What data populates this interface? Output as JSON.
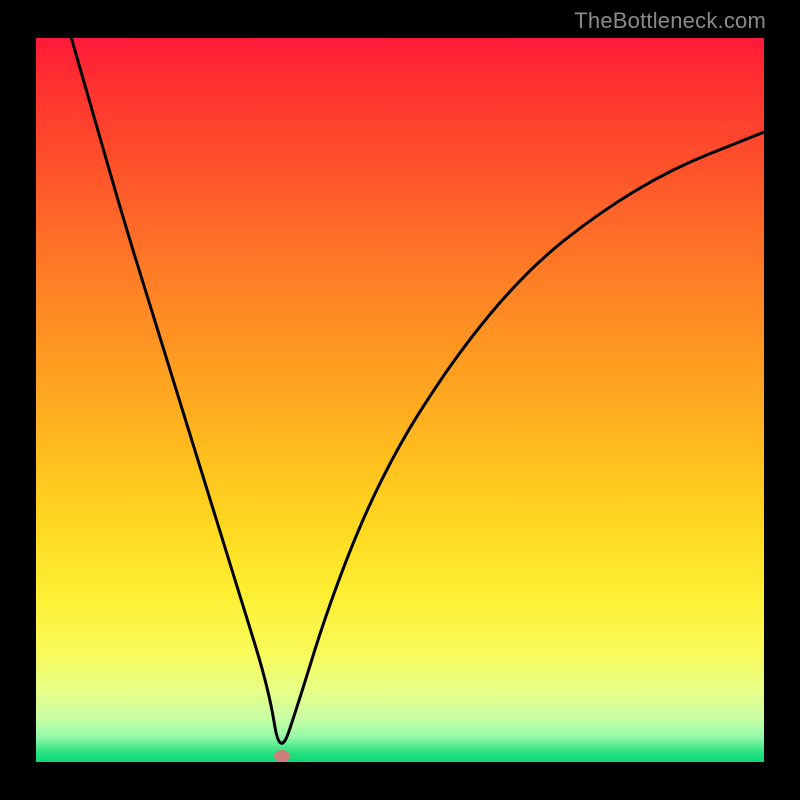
{
  "watermark": "TheBottleneck.com",
  "chart_data": {
    "type": "line",
    "title": "",
    "xlabel": "",
    "ylabel": "",
    "xlim": [
      0,
      100
    ],
    "ylim": [
      0,
      100
    ],
    "grid": false,
    "legend": false,
    "series": [
      {
        "name": "curve",
        "x": [
          4,
          8,
          12,
          16,
          20,
          24,
          28,
          32,
          33.5,
          36,
          40,
          45,
          50,
          55,
          60,
          65,
          70,
          75,
          80,
          85,
          90,
          95,
          100
        ],
        "values": [
          103,
          89,
          75,
          62,
          49,
          36,
          23,
          10,
          0.5,
          8,
          21,
          34,
          44,
          52,
          59,
          65,
          70,
          74,
          77.5,
          80.5,
          83,
          85,
          87
        ]
      }
    ],
    "marker": {
      "x": 33.8,
      "y": 0.8
    },
    "background_gradient": {
      "top": "#ff1a3a",
      "mid_upper": "#ff8824",
      "mid": "#ffda22",
      "low": "#e7ff86",
      "bottom": "#11d876"
    }
  }
}
